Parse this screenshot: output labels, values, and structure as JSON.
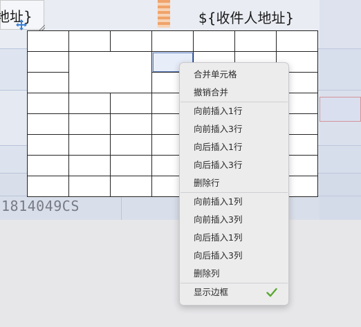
{
  "background": {
    "tracking_number": "1814049CS",
    "colors": {
      "paper": "#e4e8f0",
      "accent_orange": "#f0a36a",
      "line_blue": "#b8c4da"
    }
  },
  "template": {
    "left_placeholder": "地址}",
    "right_placeholder": "${收件人地址}"
  },
  "table": {
    "rows": 8,
    "cols": 7,
    "selected_cell": "row-2-col-4"
  },
  "context_menu": {
    "groups": [
      [
        {
          "label": "合并单元格"
        },
        {
          "label": "撤销合并"
        }
      ],
      [
        {
          "label": "向前插入1行"
        },
        {
          "label": "向前插入3行"
        },
        {
          "label": "向后插入1行"
        },
        {
          "label": "向后插入3行"
        },
        {
          "label": "删除行"
        }
      ],
      [
        {
          "label": "向前插入1列"
        },
        {
          "label": "向前插入3列"
        },
        {
          "label": "向后插入1列"
        },
        {
          "label": "向后插入3列"
        },
        {
          "label": "删除列"
        }
      ],
      [
        {
          "label": "显示边框",
          "checked": true,
          "check_icon": "checkmark-icon",
          "check_color": "#5aa832"
        }
      ]
    ]
  }
}
